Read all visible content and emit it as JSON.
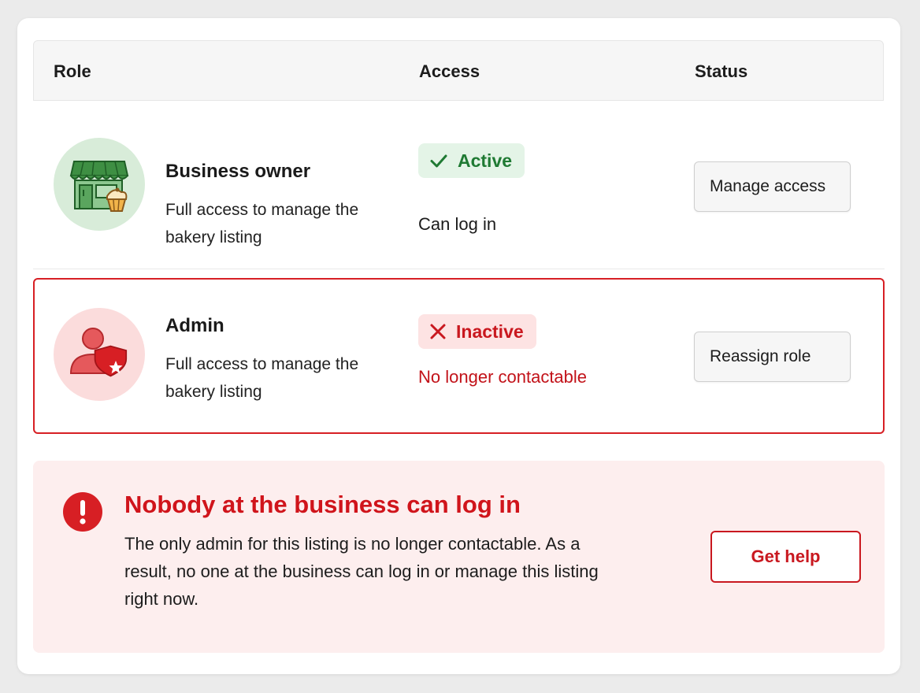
{
  "table": {
    "headers": {
      "role": "Role",
      "access": "Access",
      "status": "Status"
    },
    "rows": [
      {
        "role_name": "Business owner",
        "role_description": "Full access to manage the bakery listing",
        "avatar_icon": "storefront-with-cupcake-icon",
        "access_badge": "Active",
        "access_badge_icon": "checkmark-icon",
        "access_note": "Can log in",
        "action_label": "Manage access",
        "accent_color": "#1f7a33"
      },
      {
        "role_name": "Admin",
        "role_description": "Full access to manage the bakery listing",
        "avatar_icon": "user-shield-icon",
        "access_badge": "Inactive",
        "access_badge_icon": "x-icon",
        "access_note": "No longer contactable",
        "action_label": "Reassign role",
        "accent_color": "#d71f24"
      }
    ]
  },
  "alert": {
    "icon": "exclamation-circle-icon",
    "title": "Nobody at the business can log in",
    "body": "The only admin for this listing is no longer contactable. As a result, no one at the business can log in or manage this listing right now.",
    "button_label": "Get help",
    "color": "#d0141b"
  }
}
